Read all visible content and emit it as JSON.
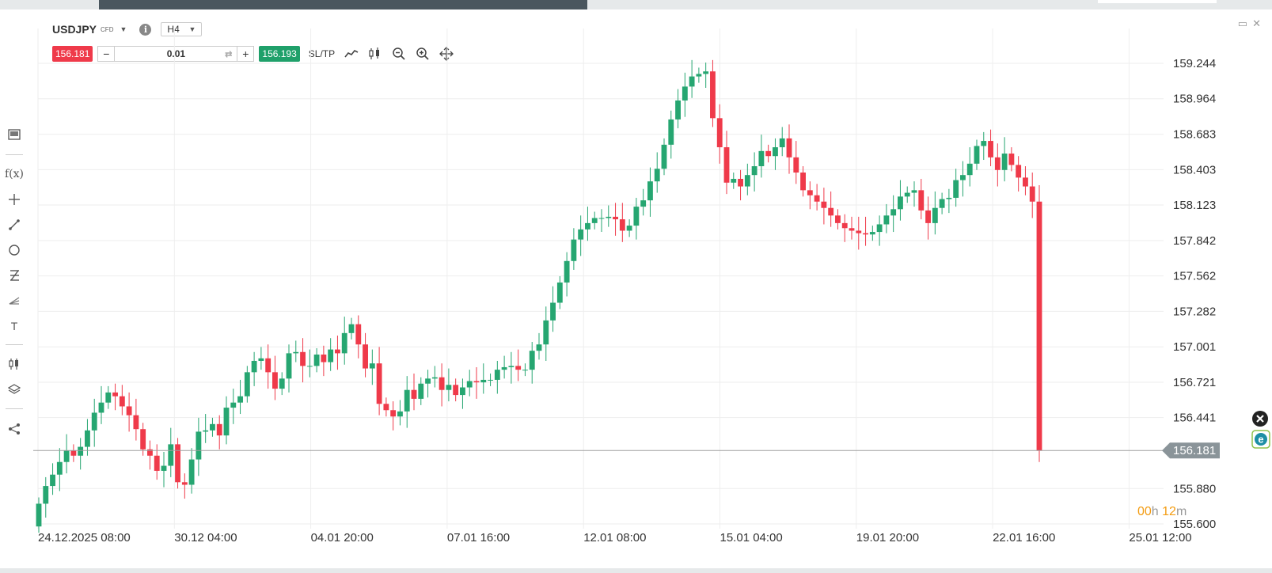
{
  "instrument": {
    "symbol": "USDJPY",
    "type_badge": "CFD",
    "timeframe": "H4"
  },
  "trade": {
    "sell_price": "156.181",
    "minus_label": "−",
    "quantity": "0.01",
    "plus_label": "+",
    "buy_price": "156.193",
    "sltp_label": "SL/TP"
  },
  "chart": {
    "price_labels": [
      "159.244",
      "158.964",
      "158.683",
      "158.403",
      "158.123",
      "157.842",
      "157.562",
      "157.282",
      "157.001",
      "156.721",
      "156.441",
      "155.880",
      "155.600"
    ],
    "current_price_label": "156.181",
    "time_labels": [
      "24.12.2025 08:00",
      "30.12 04:00",
      "04.01 20:00",
      "07.01 16:00",
      "12.01 08:00",
      "15.01 04:00",
      "19.01 20:00",
      "22.01 16:00",
      "25.01 12:00"
    ],
    "timer": {
      "hours": "00",
      "h_unit": "h",
      "minutes": "12",
      "m_unit": "m"
    }
  },
  "colors": {
    "up": "#26a671",
    "down": "#ef3a4a",
    "grid": "#eeeeee"
  },
  "chart_data": {
    "type": "candlestick",
    "title": "USDJPY H4",
    "yaxis_ticks": [
      159.244,
      158.964,
      158.683,
      158.403,
      158.123,
      157.842,
      157.562,
      157.282,
      157.001,
      156.721,
      156.441,
      155.88,
      155.6
    ],
    "ylim": [
      155.55,
      159.45
    ],
    "current_price": 156.181,
    "candles_close": [
      155.76,
      155.9,
      155.99,
      156.09,
      156.18,
      156.14,
      156.21,
      156.34,
      156.48,
      156.56,
      156.64,
      156.61,
      156.53,
      156.46,
      156.35,
      156.19,
      156.14,
      156.02,
      156.06,
      156.23,
      155.93,
      155.91,
      156.11,
      156.33,
      156.34,
      156.39,
      156.3,
      156.52,
      156.56,
      156.61,
      156.8,
      156.89,
      156.91,
      156.8,
      156.67,
      156.75,
      156.95,
      156.96,
      156.85,
      156.85,
      156.94,
      156.88,
      156.98,
      156.95,
      157.11,
      157.18,
      157.02,
      156.83,
      156.87,
      156.55,
      156.5,
      156.45,
      156.49,
      156.66,
      156.59,
      156.71,
      156.75,
      156.76,
      156.66,
      156.7,
      156.62,
      156.68,
      156.73,
      156.72,
      156.74,
      156.74,
      156.82,
      156.84,
      156.85,
      156.82,
      156.82,
      156.97,
      157.02,
      157.21,
      157.35,
      157.51,
      157.68,
      157.85,
      157.93,
      157.98,
      158.02,
      158.02,
      158.03,
      158.01,
      157.92,
      157.96,
      158.11,
      158.16,
      158.31,
      158.41,
      158.6,
      158.8,
      158.95,
      159.06,
      159.14,
      159.16,
      159.18,
      158.81,
      158.58,
      158.3,
      158.33,
      158.27,
      158.36,
      158.43,
      158.55,
      158.51,
      158.58,
      158.65,
      158.5,
      158.38,
      158.24,
      158.2,
      158.15,
      158.1,
      158.04,
      157.98,
      157.94,
      157.92,
      157.9,
      157.89,
      157.91,
      157.97,
      158.04,
      158.09,
      158.19,
      158.22,
      158.24,
      158.08,
      157.98,
      158.1,
      158.17,
      158.18,
      158.32,
      158.36,
      158.45,
      158.59,
      158.63,
      158.5,
      158.4,
      158.53,
      158.44,
      158.34,
      158.27,
      158.15,
      156.18
    ]
  }
}
